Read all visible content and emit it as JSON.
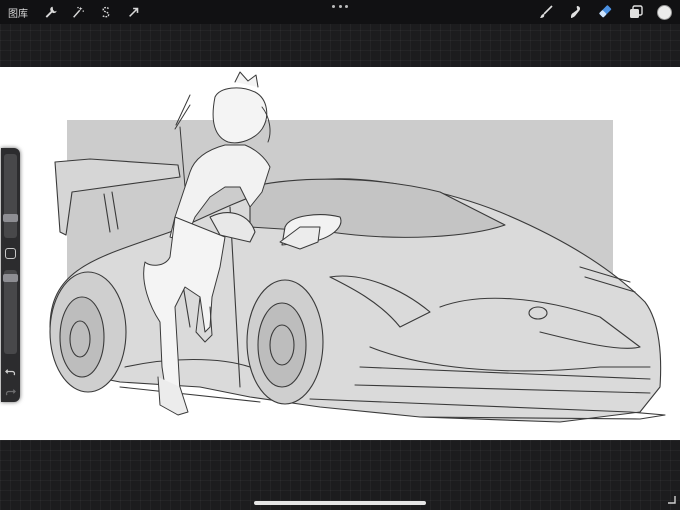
{
  "topbar": {
    "gallery_label": "图库",
    "left_tools": [
      {
        "name": "actions",
        "icon": "wrench-icon"
      },
      {
        "name": "adjustments",
        "icon": "magic-wand-icon"
      },
      {
        "name": "selection",
        "icon": "selection-s-icon"
      },
      {
        "name": "transform",
        "icon": "arrow-cursor-icon"
      }
    ],
    "right_tools": [
      {
        "name": "brush",
        "icon": "brush-icon"
      },
      {
        "name": "smudge",
        "icon": "smudge-icon"
      },
      {
        "name": "eraser",
        "icon": "eraser-icon",
        "active": true
      },
      {
        "name": "layers",
        "icon": "layers-icon"
      },
      {
        "name": "color",
        "icon": "color-swatch"
      }
    ],
    "more_icon": "more-dots-icon",
    "active_color": "#4a90e2",
    "current_color": "#ececec"
  },
  "canvas": {
    "background": "#ffffff",
    "backdrop_color": "#cccccc",
    "artwork": "line-art-car-and-character"
  },
  "sidebar": {
    "size_slider": {
      "icon": "brush-size-slider",
      "value": 0.25
    },
    "modify_button": {
      "icon": "modify-square-icon"
    },
    "opacity_slider": {
      "icon": "opacity-slider",
      "value": 0.95
    },
    "undo": {
      "icon": "undo-icon"
    },
    "redo": {
      "icon": "redo-icon"
    }
  }
}
